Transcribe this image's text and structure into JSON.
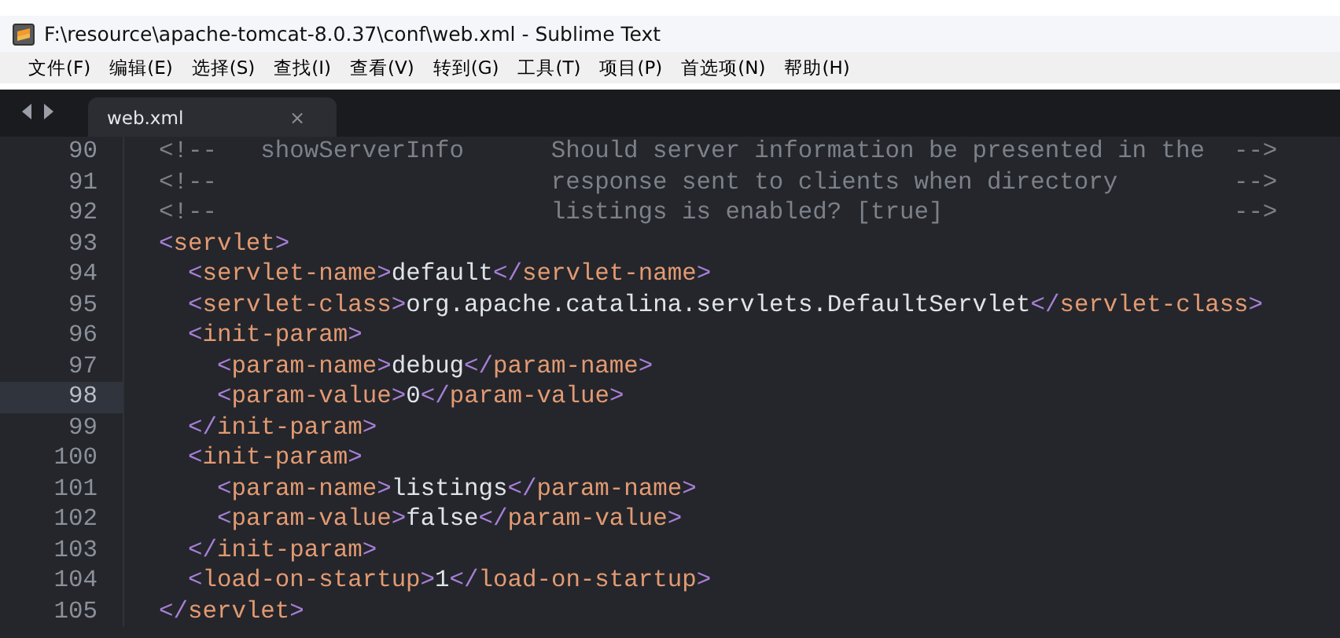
{
  "window": {
    "title": "F:\\resource\\apache-tomcat-8.0.37\\conf\\web.xml - Sublime Text"
  },
  "menu": [
    "文件(F)",
    "编辑(E)",
    "选择(S)",
    "查找(I)",
    "查看(V)",
    "转到(G)",
    "工具(T)",
    "项目(P)",
    "首选项(N)",
    "帮助(H)"
  ],
  "tabs": [
    {
      "label": "web.xml",
      "selected": true,
      "close": "×"
    }
  ],
  "lines": [
    {
      "number": "90",
      "selected": false,
      "tokens": [
        {
          "kind": "comment",
          "text": "<!--   showServerInfo      Should server information be presented in the  -->"
        }
      ]
    },
    {
      "number": "91",
      "selected": false,
      "tokens": [
        {
          "kind": "comment",
          "text": "<!--                       response sent to clients when directory        -->"
        }
      ]
    },
    {
      "number": "92",
      "selected": false,
      "tokens": [
        {
          "kind": "comment",
          "text": "<!--                       listings is enabled? [true]                    -->"
        }
      ]
    },
    {
      "number": "93",
      "selected": false,
      "tokens": [
        {
          "kind": "punct",
          "text": "<"
        },
        {
          "kind": "name",
          "text": "servlet"
        },
        {
          "kind": "punct",
          "text": ">"
        }
      ],
      "children": [
        {
          "number": "94",
          "selected": false,
          "tokens": [
            {
              "kind": "punct",
              "text": "<"
            },
            {
              "kind": "name",
              "text": "servlet-name"
            },
            {
              "kind": "punct",
              "text": ">"
            },
            {
              "kind": "text",
              "text": "default"
            },
            {
              "kind": "punct",
              "text": "</"
            },
            {
              "kind": "name",
              "text": "servlet-name"
            },
            {
              "kind": "punct",
              "text": ">"
            }
          ]
        },
        {
          "number": "95",
          "selected": false,
          "tokens": [
            {
              "kind": "punct",
              "text": "<"
            },
            {
              "kind": "name",
              "text": "servlet-class"
            },
            {
              "kind": "punct",
              "text": ">"
            },
            {
              "kind": "text",
              "text": "org.apache.catalina.servlets.DefaultServlet"
            },
            {
              "kind": "punct",
              "text": "</"
            },
            {
              "kind": "name",
              "text": "servlet-class"
            },
            {
              "kind": "punct",
              "text": ">"
            }
          ]
        },
        {
          "number": "96",
          "selected": false,
          "tokens": [
            {
              "kind": "punct",
              "text": "<"
            },
            {
              "kind": "name",
              "text": "init-param"
            },
            {
              "kind": "punct",
              "text": ">"
            }
          ],
          "children": [
            {
              "number": "97",
              "selected": false,
              "tokens": [
                {
                  "kind": "punct",
                  "text": "<"
                },
                {
                  "kind": "name",
                  "text": "param-name"
                },
                {
                  "kind": "punct",
                  "text": ">"
                },
                {
                  "kind": "text",
                  "text": "debug"
                },
                {
                  "kind": "punct",
                  "text": "</"
                },
                {
                  "kind": "name",
                  "text": "param-name"
                },
                {
                  "kind": "punct",
                  "text": ">"
                }
              ]
            },
            {
              "number": "98",
              "selected": true,
              "tokens": [
                {
                  "kind": "punct",
                  "text": "<"
                },
                {
                  "kind": "name",
                  "text": "param-value"
                },
                {
                  "kind": "punct",
                  "text": ">"
                },
                {
                  "kind": "text",
                  "text": "0"
                },
                {
                  "kind": "punct",
                  "text": "</"
                },
                {
                  "kind": "name",
                  "text": "param-value"
                },
                {
                  "kind": "punct",
                  "text": ">"
                }
              ]
            }
          ]
        },
        {
          "number": "99",
          "selected": false,
          "tokens": [
            {
              "kind": "punct",
              "text": "</"
            },
            {
              "kind": "name",
              "text": "init-param"
            },
            {
              "kind": "punct",
              "text": ">"
            }
          ]
        },
        {
          "number": "100",
          "selected": false,
          "tokens": [
            {
              "kind": "punct",
              "text": "<"
            },
            {
              "kind": "name",
              "text": "init-param"
            },
            {
              "kind": "punct",
              "text": ">"
            }
          ],
          "children": [
            {
              "number": "101",
              "selected": false,
              "tokens": [
                {
                  "kind": "punct",
                  "text": "<"
                },
                {
                  "kind": "name",
                  "text": "param-name"
                },
                {
                  "kind": "punct",
                  "text": ">"
                },
                {
                  "kind": "text",
                  "text": "listings"
                },
                {
                  "kind": "punct",
                  "text": "</"
                },
                {
                  "kind": "name",
                  "text": "param-name"
                },
                {
                  "kind": "punct",
                  "text": ">"
                }
              ]
            },
            {
              "number": "102",
              "selected": false,
              "tokens": [
                {
                  "kind": "punct",
                  "text": "<"
                },
                {
                  "kind": "name",
                  "text": "param-value"
                },
                {
                  "kind": "punct",
                  "text": ">"
                },
                {
                  "kind": "text",
                  "text": "false"
                },
                {
                  "kind": "punct",
                  "text": "</"
                },
                {
                  "kind": "name",
                  "text": "param-value"
                },
                {
                  "kind": "punct",
                  "text": ">"
                }
              ]
            }
          ]
        },
        {
          "number": "103",
          "selected": false,
          "tokens": [
            {
              "kind": "punct",
              "text": "</"
            },
            {
              "kind": "name",
              "text": "init-param"
            },
            {
              "kind": "punct",
              "text": ">"
            }
          ]
        },
        {
          "number": "104",
          "selected": false,
          "tokens": [
            {
              "kind": "punct",
              "text": "<"
            },
            {
              "kind": "name",
              "text": "load-on-startup"
            },
            {
              "kind": "punct",
              "text": ">"
            },
            {
              "kind": "text",
              "text": "1"
            },
            {
              "kind": "punct",
              "text": "</"
            },
            {
              "kind": "name",
              "text": "load-on-startup"
            },
            {
              "kind": "punct",
              "text": ">"
            }
          ]
        }
      ]
    },
    {
      "number": "105",
      "selected": false,
      "tokens": [
        {
          "kind": "punct",
          "text": "</"
        },
        {
          "kind": "name",
          "text": "servlet"
        },
        {
          "kind": "punct",
          "text": ">"
        }
      ]
    }
  ]
}
